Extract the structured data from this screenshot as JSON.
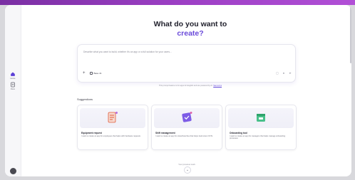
{
  "hero": {
    "title_line1": "What do you want to",
    "title_line2": "create?"
  },
  "prompt": {
    "placeholder": "Describe what you want to build, whether it's an app or a full solution for your users...",
    "chip_label": "Base 41",
    "plus_icon": "plus-icon",
    "tool_icons": [
      "image-icon",
      "mic-icon",
      "send-icon"
    ]
  },
  "disclaimer": {
    "text": "This prompt feature is for apps for English and are powered by AI.",
    "link": "See terms"
  },
  "rail": {
    "items": [
      {
        "label": "Home",
        "icon": "home-icon"
      },
      {
        "label": "Docs",
        "icon": "document-icon"
      }
    ]
  },
  "suggestions": {
    "heading": "Suggestions",
    "cards": [
      {
        "title": "Equipment request",
        "description": "I want to create an app for employees that helps with hardware requests",
        "icon": "document-list-icon",
        "accent": "#e05b3a"
      },
      {
        "title": "Shift management",
        "description": "I want to create an app for store/branches that helps track store OOTs",
        "icon": "shield-check-icon",
        "accent": "#6a4ad9"
      },
      {
        "title": "Onboarding tool",
        "description": "I want to create an app for managers that helps manage onboarding processes",
        "icon": "calendar-icon",
        "accent": "#2fa36b"
      }
    ]
  },
  "footer": {
    "scroll_hint": "Your previous work",
    "scroll_icon": "chevron-down-icon"
  },
  "colors": {
    "brand_bar": "#9c3fc4",
    "accent": "#6a4ad9"
  }
}
